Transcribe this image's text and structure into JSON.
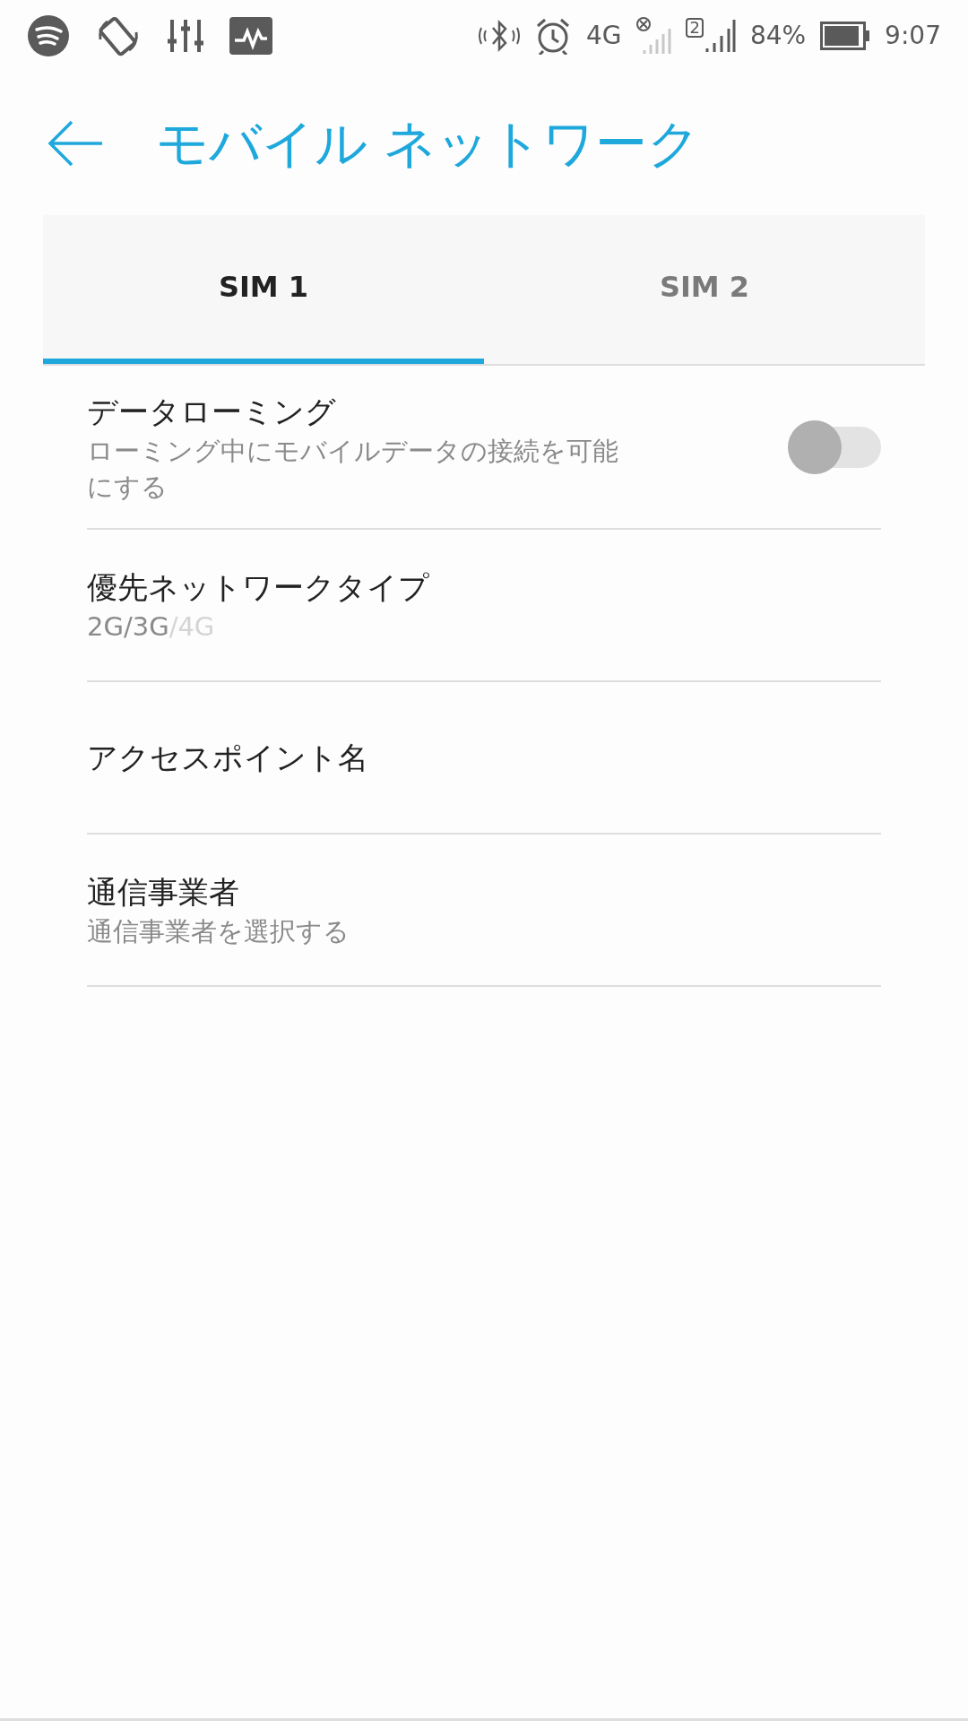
{
  "status_bar": {
    "network": "4G",
    "sim_label": "2",
    "battery": "84%",
    "time": "9:07"
  },
  "header": {
    "title": "モバイル ネットワーク"
  },
  "tabs": [
    {
      "label": "SIM 1",
      "selected": true
    },
    {
      "label": "SIM 2",
      "selected": false
    }
  ],
  "settings": [
    {
      "kind": "toggle",
      "title": "データローミング",
      "summary": "ローミング中にモバイルデータの接続を可能にする",
      "on": false
    },
    {
      "kind": "parts",
      "title": "優先ネットワークタイプ",
      "summary_parts": [
        {
          "text": "2G/3G",
          "dimmed": false
        },
        {
          "text": "/4G",
          "dimmed": true
        }
      ]
    },
    {
      "kind": "plain",
      "title": "アクセスポイント名"
    },
    {
      "kind": "plain",
      "title": "通信事業者",
      "summary": "通信事業者を選択する"
    }
  ]
}
